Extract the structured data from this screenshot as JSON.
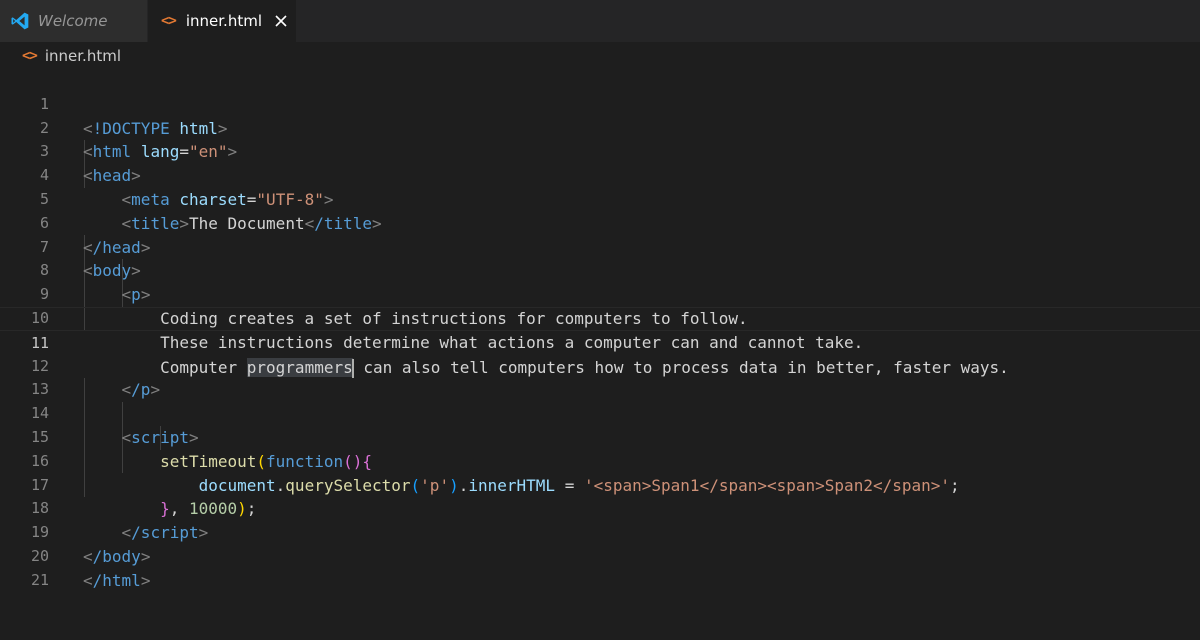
{
  "tabs": [
    {
      "label": "Welcome",
      "icon": "vscode-icon"
    },
    {
      "label": "inner.html",
      "icon": "html-file-icon",
      "close": "close-icon"
    }
  ],
  "breadcrumb": {
    "file": "inner.html"
  },
  "editor": {
    "current_line": 11,
    "lines": [
      {
        "n": "1"
      },
      {
        "n": "2"
      },
      {
        "n": "3"
      },
      {
        "n": "4"
      },
      {
        "n": "5"
      },
      {
        "n": "6"
      },
      {
        "n": "7"
      },
      {
        "n": "8"
      },
      {
        "n": "9"
      },
      {
        "n": "10"
      },
      {
        "n": "11"
      },
      {
        "n": "12"
      },
      {
        "n": "13"
      },
      {
        "n": "14"
      },
      {
        "n": "15"
      },
      {
        "n": "16"
      },
      {
        "n": "17"
      },
      {
        "n": "18"
      },
      {
        "n": "19"
      },
      {
        "n": "20"
      },
      {
        "n": "21"
      }
    ],
    "code": {
      "l1_doctype": "!DOCTYPE",
      "l1_html": "html",
      "l2_html": "html",
      "l2_lang": "lang",
      "l2_en": "\"en\"",
      "l3_head": "head",
      "l4_meta": "meta",
      "l4_charset": "charset",
      "l4_utf": "\"UTF-8\"",
      "l5_title": "title",
      "l5_text": "The Document",
      "l5_title_close": "/title",
      "l6_head": "/head",
      "l7_body": "body",
      "l8_p": "p",
      "l9_text": "Coding creates a set of instructions for computers to follow.",
      "l10_text": "These instructions determine what actions a computer can and cannot take.",
      "l11_pre": "Computer ",
      "l11_hl": "programmers",
      "l11_post": " can also tell computers how to process data in better, faster ways.",
      "l12_p": "/p",
      "l14_script": "script",
      "l15_fn": "setTimeout",
      "l15_kw": "function",
      "l16_doc": "document",
      "l16_qs": "querySelector",
      "l16_arg": "'p'",
      "l16_prop": "innerHTML",
      "l16_str": "'<span>Span1</span><span>Span2</span>'",
      "l17_num": "10000",
      "l18_script": "/script",
      "l19_body": "/body",
      "l20_html": "/html"
    }
  },
  "colors": {
    "background": "#1e1e1e",
    "tab_bar": "#252526",
    "inactive_tab": "#2d2d2d",
    "html_icon": "#e37933",
    "vscode_blue": "#23a9f2"
  }
}
